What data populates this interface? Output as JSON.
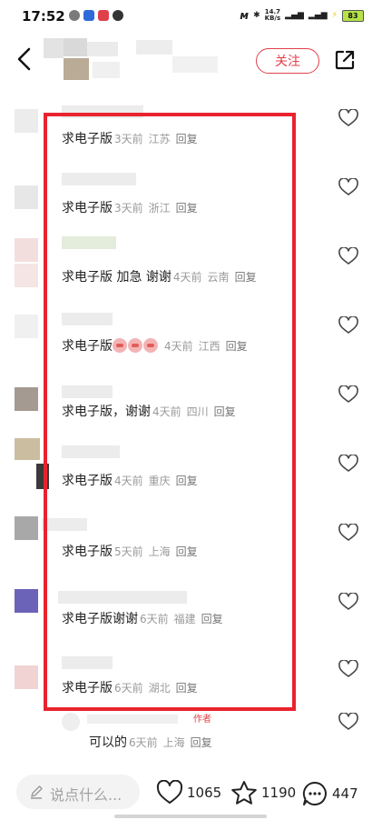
{
  "status_bar": {
    "time": "17:52",
    "speed": "14.7",
    "speed_unit": "KB/s",
    "battery": "83"
  },
  "header": {
    "follow_label": "关注"
  },
  "comments": [
    {
      "text": "求电子版",
      "time": "3天前",
      "location": "江苏",
      "reply": "回复"
    },
    {
      "text": "求电子版",
      "time": "3天前",
      "location": "浙江",
      "reply": "回复"
    },
    {
      "text": "求电子版 加急 谢谢",
      "time": "4天前",
      "location": "云南",
      "reply": "回复"
    },
    {
      "text": "求电子版",
      "time": "4天前",
      "location": "江西",
      "reply": "回复"
    },
    {
      "text": "求电子版，谢谢",
      "time": "4天前",
      "location": "四川",
      "reply": "回复"
    },
    {
      "text": "求电子版",
      "time": "4天前",
      "location": "重庆",
      "reply": "回复"
    },
    {
      "text": "求电子版",
      "time": "5天前",
      "location": "上海",
      "reply": "回复"
    },
    {
      "text": "求电子版谢谢",
      "time": "6天前",
      "location": "福建",
      "reply": "回复"
    },
    {
      "text": "求电子版",
      "time": "6天前",
      "location": "湖北",
      "reply": "回复"
    }
  ],
  "author_reply": {
    "tag": "作者",
    "text": "可以的",
    "time": "6天前",
    "location": "上海",
    "reply": "回复"
  },
  "bottom_bar": {
    "input_placeholder": "说点什么...",
    "likes": "1065",
    "collects": "1190",
    "comments": "447"
  },
  "colors": {
    "accent": "#e0404a",
    "highlight_box": "#e8232e",
    "meta_gray": "#9a9a9a"
  }
}
